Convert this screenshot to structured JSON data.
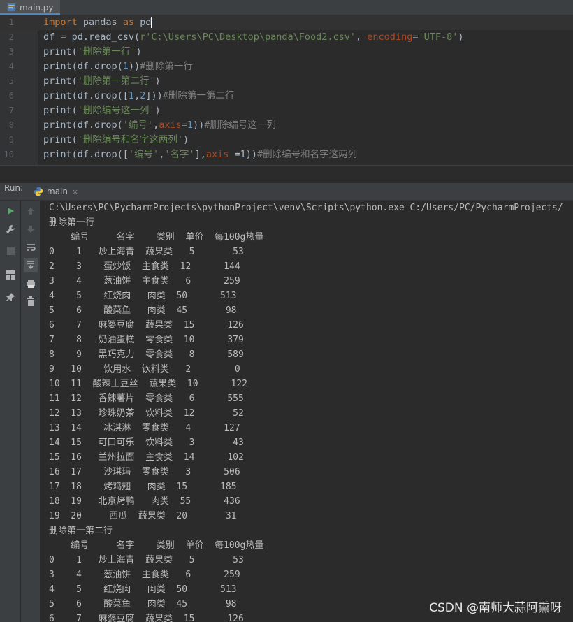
{
  "tab": {
    "label": "main.py"
  },
  "editor": {
    "lines": [
      {
        "num": "1",
        "tokens": [
          [
            "kw",
            "import"
          ],
          [
            "t",
            " pandas "
          ],
          [
            "kw",
            "as"
          ],
          [
            "t",
            " pd"
          ]
        ]
      },
      {
        "num": "2",
        "tokens": [
          [
            "t",
            "df = pd.read_csv("
          ],
          [
            "str",
            "r'C:\\Users\\PC\\Desktop\\panda\\Food2.csv'"
          ],
          [
            "t",
            ","
          ],
          [
            "param",
            " encoding"
          ],
          [
            "t",
            "="
          ],
          [
            "str",
            "'UTF-8'"
          ],
          [
            "t",
            ")"
          ]
        ]
      },
      {
        "num": "3",
        "tokens": [
          [
            "t",
            "print("
          ],
          [
            "str",
            "'删除第一行'"
          ],
          [
            "t",
            ")"
          ]
        ]
      },
      {
        "num": "4",
        "tokens": [
          [
            "t",
            "print(df.drop("
          ],
          [
            "num",
            "1"
          ],
          [
            "t",
            "))"
          ],
          [
            "cmt",
            "#删除第一行"
          ]
        ]
      },
      {
        "num": "5",
        "tokens": [
          [
            "t",
            "print("
          ],
          [
            "str",
            "'删除第一第二行'"
          ],
          [
            "t",
            ")"
          ]
        ]
      },
      {
        "num": "6",
        "tokens": [
          [
            "t",
            "print(df.drop(["
          ],
          [
            "num",
            "1"
          ],
          [
            "t",
            ","
          ],
          [
            "num",
            "2"
          ],
          [
            "t",
            "]))"
          ],
          [
            "cmt",
            "#删除第一第二行"
          ]
        ]
      },
      {
        "num": "7",
        "tokens": [
          [
            "t",
            "print("
          ],
          [
            "str",
            "'删除编号这一列'"
          ],
          [
            "t",
            ")"
          ]
        ]
      },
      {
        "num": "8",
        "tokens": [
          [
            "t",
            "print(df.drop("
          ],
          [
            "str",
            "'编号'"
          ],
          [
            "t",
            ","
          ],
          [
            "param",
            "axis"
          ],
          [
            "t",
            "="
          ],
          [
            "num",
            "1"
          ],
          [
            "t",
            "))"
          ],
          [
            "cmt",
            "#删除编号这一列"
          ]
        ]
      },
      {
        "num": "9",
        "tokens": [
          [
            "t",
            "print("
          ],
          [
            "str",
            "'删除编号和名字这两列'"
          ],
          [
            "t",
            ")"
          ]
        ]
      },
      {
        "num": "10",
        "tokens": [
          [
            "t",
            "print(df.drop(["
          ],
          [
            "str",
            "'编号'"
          ],
          [
            "t",
            ","
          ],
          [
            "str",
            "'名字'"
          ],
          [
            "t",
            "],"
          ],
          [
            "param",
            "axis "
          ],
          [
            "t",
            "=1))"
          ],
          [
            "cmt",
            "#删除编号和名字这两列"
          ]
        ]
      }
    ]
  },
  "run": {
    "label": "Run:",
    "tab": "main"
  },
  "console": {
    "lines": [
      "C:\\Users\\PC\\PycharmProjects\\pythonProject\\venv\\Scripts\\python.exe C:/Users/PC/PycharmProjects/",
      "删除第一行",
      "    编号     名字    类别  单价  每100g热量",
      "0    1   炒上海青  蔬果类   5       53",
      "2    3    蛋炒饭  主食类  12      144",
      "3    4    葱油饼  主食类   6      259",
      "4    5    红烧肉   肉类  50      513",
      "5    6    酸菜鱼   肉类  45       98",
      "6    7   麻婆豆腐  蔬果类  15      126",
      "7    8   奶油蛋糕  零食类  10      379",
      "8    9   黑巧克力  零食类   8      589",
      "9   10    饮用水  饮料类   2        0",
      "10  11  酸辣土豆丝  蔬果类  10      122",
      "11  12   香辣薯片  零食类   6      555",
      "12  13   珍珠奶茶  饮料类  12       52",
      "13  14    冰淇淋  零食类   4      127",
      "14  15   可口可乐  饮料类   3       43",
      "15  16   兰州拉面  主食类  14      102",
      "16  17    沙琪玛  零食类   3      506",
      "17  18    烤鸡翅   肉类  15      185",
      "18  19   北京烤鸭   肉类  55      436",
      "19  20     西瓜  蔬果类  20       31",
      "删除第一第二行",
      "    编号     名字    类别  单价  每100g热量",
      "0    1   炒上海青  蔬果类   5       53",
      "3    4    葱油饼  主食类   6      259",
      "4    5    红烧肉   肉类  50      513",
      "5    6    酸菜鱼   肉类  45       98",
      "6    7   麻婆豆腐  蔬果类  15      126"
    ]
  },
  "watermark": "CSDN @南师大蒜阿熏呀"
}
